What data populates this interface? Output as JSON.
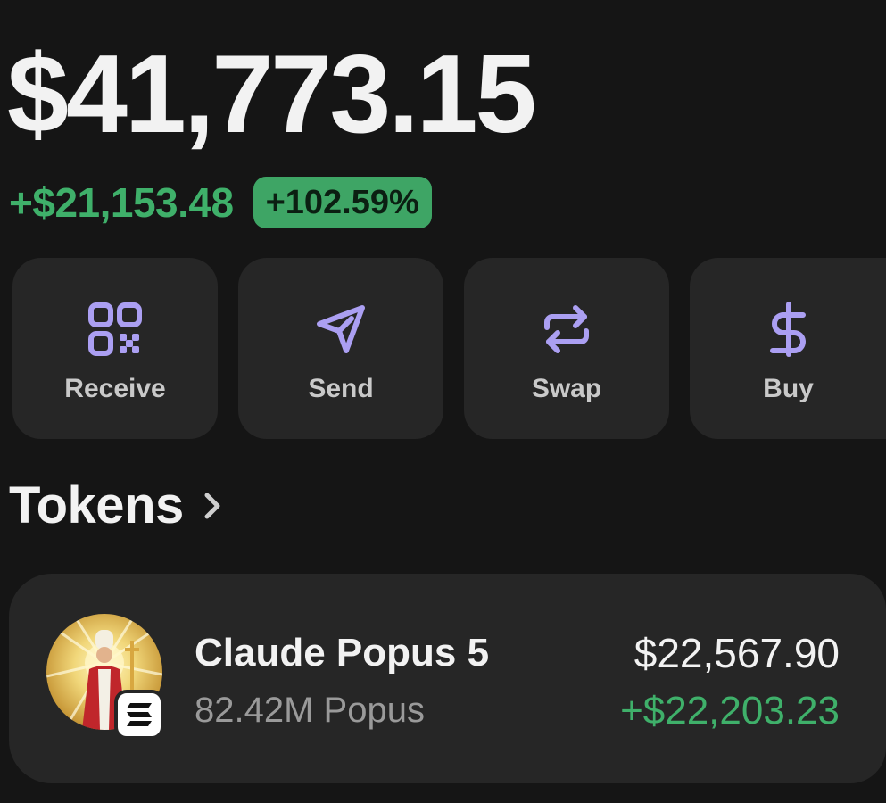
{
  "portfolio": {
    "balance": "$41,773.15",
    "change_amount": "+$21,153.48",
    "change_percent": "+102.59%"
  },
  "actions": [
    {
      "label": "Receive",
      "icon": "qr-code-icon"
    },
    {
      "label": "Send",
      "icon": "send-icon"
    },
    {
      "label": "Swap",
      "icon": "swap-icon"
    },
    {
      "label": "Buy",
      "icon": "dollar-icon"
    }
  ],
  "tokens_section": {
    "title": "Tokens",
    "chevron_icon": "chevron-right-icon"
  },
  "tokens": [
    {
      "name": "Claude Popus 5",
      "quantity": "82.42M Popus",
      "value": "$22,567.90",
      "change": "+$22,203.23",
      "avatar_icon": "token-avatar-image",
      "chain_icon": "solana-icon"
    }
  ],
  "colors": {
    "background": "#151515",
    "card": "#262626",
    "positive": "#3fb06a",
    "positive_badge": "#3ea565",
    "accent_icon": "#ab9ff2"
  }
}
